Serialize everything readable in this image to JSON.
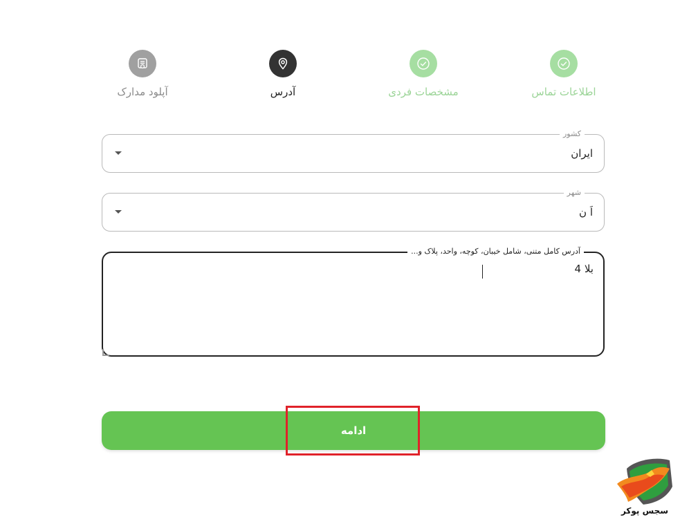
{
  "stepper": {
    "steps": [
      {
        "label": "اطلاعات تماس",
        "state": "done",
        "icon": "check-circle-icon"
      },
      {
        "label": "مشخصات فردی",
        "state": "done",
        "icon": "check-circle-icon"
      },
      {
        "label": "آدرس",
        "state": "active",
        "icon": "location-pin-icon"
      },
      {
        "label": "آپلود مدارک",
        "state": "pending",
        "icon": "document-badge-icon"
      }
    ]
  },
  "form": {
    "country": {
      "label": "کشور",
      "value": "ایران"
    },
    "city": {
      "label": "شهر",
      "value": "اَ   ن"
    },
    "address": {
      "label": "آدرس کامل متنی، شامل خیبان، کوچه، واحد، پلاک و...",
      "value": "بلا                              4"
    }
  },
  "actions": {
    "continue_label": "ادامه"
  },
  "brand": {
    "watermark_text": "سجس پوکر"
  },
  "colors": {
    "primary_green": "#65c453",
    "done_green": "#a6dea2",
    "active_dark": "#333333",
    "pending_gray": "#a0a0a0",
    "highlight_red": "#e0222a"
  }
}
